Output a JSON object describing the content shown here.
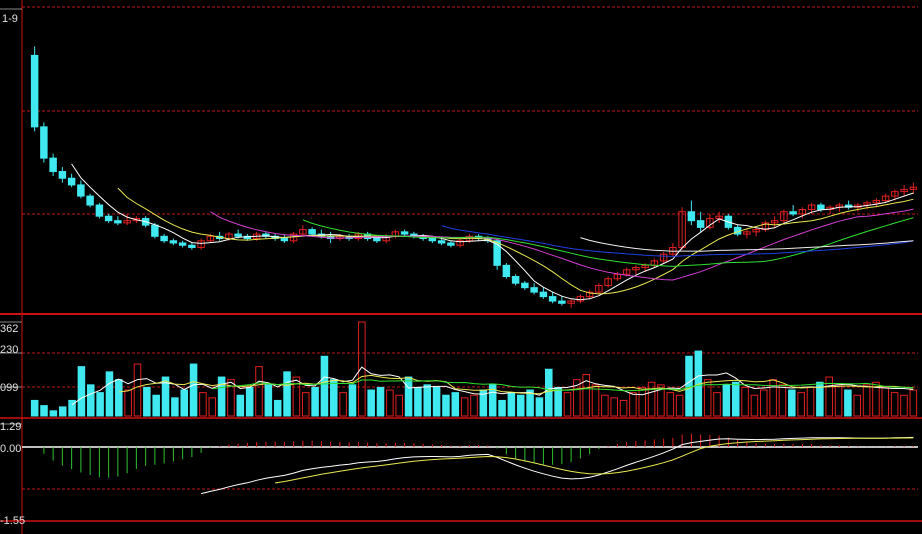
{
  "colors": {
    "background": "#000000",
    "panel_border": "#d01010",
    "grid": "#c01818",
    "up_candle": "#e02020",
    "down_candle": "#40e8f0",
    "ma5": "#ffffff",
    "ma10": "#e8e850",
    "ma20": "#d040d0",
    "ma30": "#30e030",
    "ma60": "#2040e0",
    "ma120": "#f0f0f0",
    "macd_dif": "#ffffff",
    "macd_dea": "#e8e850",
    "macd_pos": "#e02020",
    "macd_neg": "#30c030",
    "zero_line": "#ffffff"
  },
  "labels": {
    "price_top": "1-9",
    "vol_1": "362",
    "vol_2": "230",
    "vol_3": "099",
    "macd_top": "1.29",
    "macd_zero": "0.00",
    "macd_bottom": "-1.55"
  },
  "chart_data": [
    {
      "type": "candlestick",
      "ylim": [
        0,
        100
      ],
      "candles": [
        [
          90,
          94,
          56,
          58
        ],
        [
          58,
          60,
          42,
          44
        ],
        [
          44,
          46,
          36,
          38
        ],
        [
          38,
          40,
          33,
          35
        ],
        [
          35,
          37,
          31,
          32
        ],
        [
          32,
          34,
          26,
          27
        ],
        [
          27,
          28,
          22,
          23
        ],
        [
          23,
          24,
          17,
          18
        ],
        [
          18,
          19,
          15,
          16
        ],
        [
          16,
          18,
          14,
          15
        ],
        [
          15,
          19,
          14,
          16
        ],
        [
          16,
          18,
          15,
          17
        ],
        [
          17,
          18,
          13,
          14
        ],
        [
          14,
          15,
          8,
          9
        ],
        [
          9,
          10,
          6,
          7
        ],
        [
          7,
          8,
          5,
          6
        ],
        [
          6,
          7,
          4,
          5
        ],
        [
          5,
          6,
          3,
          4
        ],
        [
          4,
          8,
          3,
          7
        ],
        [
          7,
          10,
          6,
          9
        ],
        [
          9,
          11,
          7,
          8
        ],
        [
          8,
          11,
          7,
          10
        ],
        [
          10,
          12,
          8,
          9
        ],
        [
          9,
          10,
          7,
          8
        ],
        [
          8,
          11,
          7,
          10
        ],
        [
          10,
          11,
          8,
          9
        ],
        [
          9,
          10,
          7,
          8
        ],
        [
          8,
          10,
          6,
          7
        ],
        [
          7,
          11,
          6,
          10
        ],
        [
          10,
          14,
          9,
          12
        ],
        [
          12,
          13,
          9,
          10
        ],
        [
          10,
          12,
          8,
          9
        ],
        [
          9,
          11,
          6,
          8
        ],
        [
          8,
          10,
          7,
          9
        ],
        [
          9,
          10,
          7,
          8
        ],
        [
          8,
          11,
          7,
          10
        ],
        [
          10,
          11,
          7,
          8
        ],
        [
          8,
          9,
          6,
          7
        ],
        [
          7,
          10,
          6,
          9
        ],
        [
          9,
          12,
          8,
          11
        ],
        [
          11,
          12,
          9,
          10
        ],
        [
          10,
          11,
          8,
          9
        ],
        [
          9,
          10,
          7,
          8
        ],
        [
          8,
          9,
          6,
          7
        ],
        [
          7,
          9,
          5,
          6
        ],
        [
          6,
          7,
          4,
          5
        ],
        [
          5,
          8,
          4,
          7
        ],
        [
          7,
          10,
          6,
          9
        ],
        [
          9,
          10,
          7,
          8
        ],
        [
          8,
          9,
          6,
          7
        ],
        [
          7,
          8,
          -6,
          -4
        ],
        [
          -4,
          -3,
          -10,
          -9
        ],
        [
          -9,
          -8,
          -13,
          -12
        ],
        [
          -12,
          -11,
          -15,
          -14
        ],
        [
          -14,
          -12,
          -17,
          -16
        ],
        [
          -16,
          -14,
          -19,
          -18
        ],
        [
          -18,
          -16,
          -21,
          -20
        ],
        [
          -20,
          -18,
          -22,
          -21
        ],
        [
          -21,
          -19,
          -23,
          -20
        ],
        [
          -20,
          -17,
          -21,
          -18
        ],
        [
          -18,
          -15,
          -19,
          -16
        ],
        [
          -16,
          -12,
          -17,
          -13
        ],
        [
          -13,
          -9,
          -14,
          -10
        ],
        [
          -10,
          -7,
          -11,
          -8
        ],
        [
          -8,
          -5,
          -9,
          -6
        ],
        [
          -6,
          -4,
          -8,
          -5
        ],
        [
          -5,
          -3,
          -7,
          -4
        ],
        [
          -4,
          -1,
          -5,
          -2
        ],
        [
          -2,
          2,
          -3,
          1
        ],
        [
          1,
          6,
          0,
          4
        ],
        [
          4,
          22,
          3,
          20
        ],
        [
          20,
          25,
          14,
          16
        ],
        [
          16,
          20,
          11,
          13
        ],
        [
          13,
          19,
          12,
          17
        ],
        [
          17,
          20,
          15,
          18
        ],
        [
          18,
          19,
          12,
          13
        ],
        [
          13,
          14,
          9,
          10
        ],
        [
          10,
          12,
          8,
          11
        ],
        [
          11,
          13,
          9,
          12
        ],
        [
          12,
          16,
          11,
          15
        ],
        [
          15,
          18,
          13,
          16
        ],
        [
          16,
          21,
          15,
          20
        ],
        [
          20,
          23,
          18,
          19
        ],
        [
          19,
          22,
          17,
          21
        ],
        [
          21,
          24,
          19,
          23
        ],
        [
          23,
          24,
          20,
          21
        ],
        [
          21,
          23,
          19,
          22
        ],
        [
          22,
          24,
          20,
          23
        ],
        [
          23,
          25,
          21,
          22
        ],
        [
          22,
          24,
          20,
          23
        ],
        [
          23,
          25,
          21,
          24
        ],
        [
          24,
          26,
          22,
          25
        ],
        [
          25,
          28,
          24,
          27
        ],
        [
          27,
          30,
          25,
          29
        ],
        [
          29,
          32,
          27,
          30
        ],
        [
          30,
          33,
          28,
          31
        ]
      ]
    },
    {
      "type": "bar",
      "ylim": [
        0,
        362
      ],
      "values": [
        60,
        40,
        20,
        35,
        60,
        190,
        120,
        90,
        170,
        140,
        100,
        200,
        110,
        80,
        150,
        70,
        100,
        200,
        90,
        70,
        150,
        140,
        80,
        110,
        190,
        120,
        60,
        170,
        150,
        90,
        110,
        230,
        140,
        90,
        120,
        362,
        100,
        110,
        100,
        80,
        150,
        110,
        120,
        110,
        80,
        90,
        70,
        80,
        100,
        120,
        60,
        90,
        80,
        100,
        70,
        180,
        110,
        90,
        140,
        160,
        120,
        80,
        70,
        60,
        90,
        110,
        130,
        120,
        90,
        80,
        230,
        250,
        140,
        90,
        120,
        130,
        110,
        80,
        100,
        140,
        120,
        100,
        90,
        110,
        130,
        150,
        120,
        100,
        80,
        120,
        130,
        110,
        90,
        80,
        100
      ]
    },
    {
      "type": "bar",
      "ylim": [
        -1.55,
        1.29
      ],
      "values": [
        0,
        0,
        0,
        0,
        0,
        0,
        0,
        0,
        0,
        0,
        0,
        0,
        0,
        0,
        0,
        0,
        0,
        0,
        0,
        0,
        0,
        0,
        0,
        0,
        0,
        0,
        0,
        0,
        0,
        0,
        0,
        0,
        0,
        0,
        0,
        0,
        0,
        0,
        0,
        0,
        0,
        0,
        0,
        0,
        0,
        0,
        0,
        0,
        0,
        0,
        0,
        0,
        0,
        0,
        0,
        0,
        0,
        0,
        0,
        0,
        0,
        0,
        0,
        0,
        0,
        0,
        0,
        0,
        0,
        0,
        0,
        0,
        0,
        0,
        0,
        0,
        0,
        0,
        0,
        0,
        0,
        0,
        0,
        0,
        0,
        0,
        0,
        0,
        0,
        0,
        0,
        0,
        0,
        0,
        0
      ]
    }
  ]
}
